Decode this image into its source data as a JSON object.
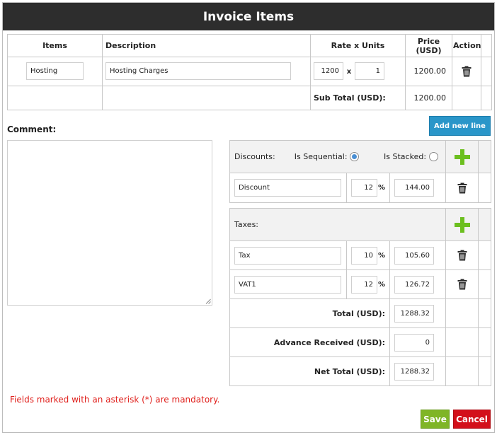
{
  "title": "Invoice Items",
  "items_table": {
    "headers": {
      "items": "Items",
      "description": "Description",
      "rate_units": "Rate x Units",
      "price": "Price (USD)",
      "action": "Action"
    },
    "row": {
      "item": "Hosting",
      "description": "Hosting Charges",
      "rate": "1200",
      "times": "x",
      "units": "1",
      "price": "1200.00"
    },
    "subtotal_label": "Sub Total (USD):",
    "subtotal_value": "1200.00"
  },
  "add_new_line_label": "Add new line",
  "comment_label": "Comment:",
  "discounts": {
    "label": "Discounts:",
    "sequential_label": "Is Sequential:",
    "stacked_label": "Is Stacked:",
    "sequential_selected": true,
    "stacked_selected": false,
    "rows": [
      {
        "name": "Discount",
        "percent": "12",
        "symbol": "%",
        "amount": "144.00"
      }
    ]
  },
  "taxes": {
    "label": "Taxes:",
    "rows": [
      {
        "name": "Tax",
        "percent": "10",
        "symbol": "%",
        "amount": "105.60"
      },
      {
        "name": "VAT1",
        "percent": "12",
        "symbol": "%",
        "amount": "126.72"
      }
    ]
  },
  "totals": {
    "total_label": "Total (USD):",
    "total_value": "1288.32",
    "advance_label": "Advance Received (USD):",
    "advance_value": "0",
    "net_label": "Net Total (USD):",
    "net_value": "1288.32"
  },
  "mandatory_note": "Fields marked with an asterisk (*) are mandatory.",
  "save_label": "Save",
  "cancel_label": "Cancel",
  "colors": {
    "titlebar": "#2d2d2d",
    "add_line_button": "#2a96c9",
    "save_button": "#7fb526",
    "cancel_button": "#d3101a",
    "plus_icon": "#6cbf1f",
    "mandatory_text": "#e0201c"
  },
  "icons": [
    "trash-icon",
    "plus-icon",
    "radio-icon",
    "resize-grip-icon"
  ]
}
